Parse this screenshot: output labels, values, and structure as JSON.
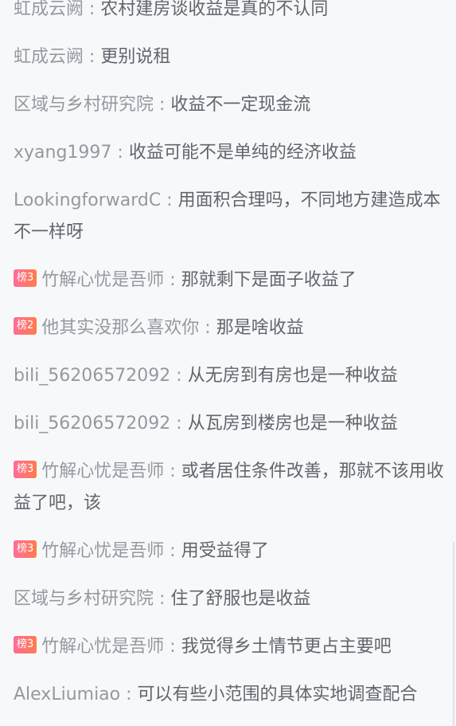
{
  "messages": [
    {
      "badge": "",
      "user": "虹成云阙",
      "sep": " : ",
      "text": "农村建房谈收益是真的不认同"
    },
    {
      "badge": "",
      "user": "虹成云阙",
      "sep": " : ",
      "text": "更别说租"
    },
    {
      "badge": "",
      "user": "区域与乡村研究院",
      "sep": " : ",
      "text": "收益不一定现金流"
    },
    {
      "badge": "",
      "user": "xyang1997",
      "sep": " : ",
      "text": "收益可能不是单纯的经济收益"
    },
    {
      "badge": "",
      "user": "LookingforwardC",
      "sep": " : ",
      "text": "用面积合理吗，不同地方建造成本不一样呀"
    },
    {
      "badge": "榜3",
      "user": "竹解心忧是吾师",
      "sep": " : ",
      "text": "那就剩下是面子收益了"
    },
    {
      "badge": "榜2",
      "user": "他其实没那么喜欢你",
      "sep": " : ",
      "text": "那是啥收益"
    },
    {
      "badge": "",
      "user": "bili_56206572092",
      "sep": " : ",
      "text": "从无房到有房也是一种收益"
    },
    {
      "badge": "",
      "user": "bili_56206572092",
      "sep": " : ",
      "text": "从瓦房到楼房也是一种收益"
    },
    {
      "badge": "榜3",
      "user": "竹解心忧是吾师",
      "sep": " : ",
      "text": "或者居住条件改善，那就不该用收益了吧，该"
    },
    {
      "badge": "榜3",
      "user": "竹解心忧是吾师",
      "sep": " : ",
      "text": "用受益得了"
    },
    {
      "badge": "",
      "user": "区域与乡村研究院",
      "sep": " : ",
      "text": "住了舒服也是收益"
    },
    {
      "badge": "榜3",
      "user": "竹解心忧是吾师",
      "sep": " : ",
      "text": "我觉得乡土情节更占主要吧"
    },
    {
      "badge": "",
      "user": "AlexLiumiao",
      "sep": " : ",
      "text": "可以有些小范围的具体实地调查配合"
    }
  ],
  "colors": {
    "background": "#f7f8fa",
    "username": "#9499a0",
    "message": "#61666d",
    "badge_start": "#ff6b9a",
    "badge_end": "#ff7d4a"
  }
}
